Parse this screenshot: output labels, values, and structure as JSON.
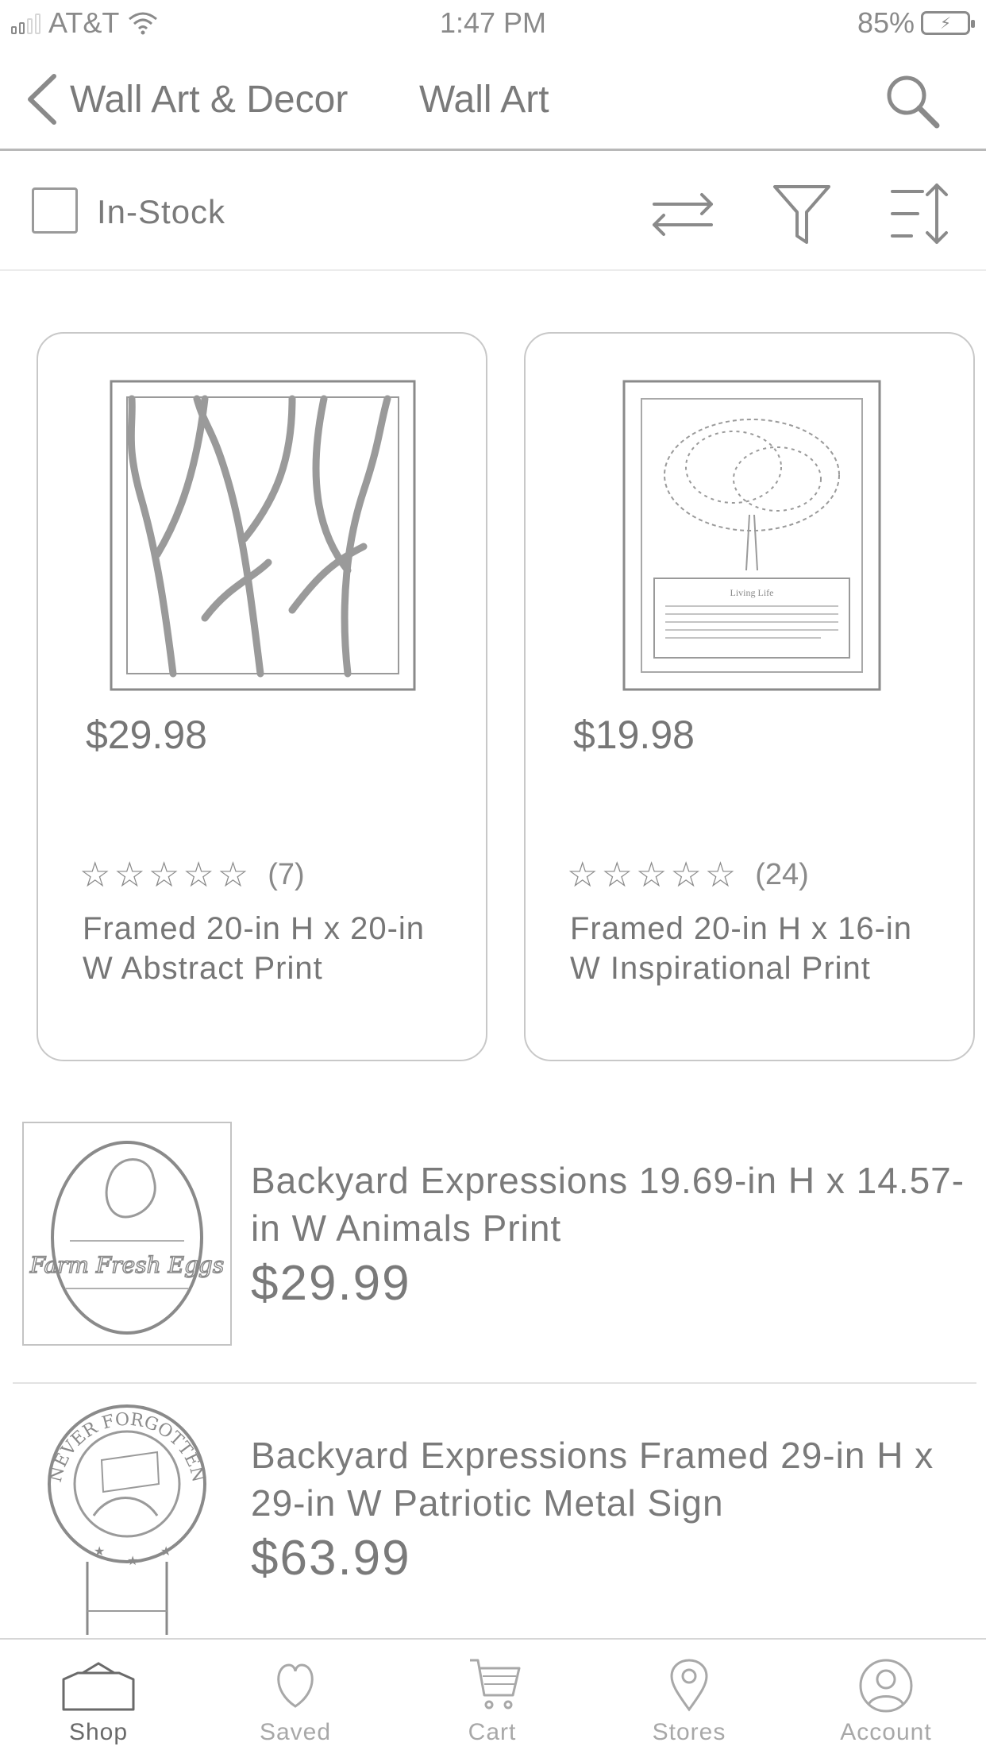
{
  "status_bar": {
    "carrier": "AT&T",
    "time": "1:47 PM",
    "battery": "85%"
  },
  "nav": {
    "parent": "Wall Art & Decor",
    "title": "Wall Art"
  },
  "filters": {
    "in_stock_label": "In-Stock",
    "in_stock_checked": false
  },
  "grid_products": [
    {
      "price": "$29.98",
      "stars": "☆☆☆☆☆",
      "rating_count": "(7)",
      "title": "Framed 20-in H x 20-in W Abstract Print"
    },
    {
      "price": "$19.98",
      "stars": "☆☆☆☆☆",
      "rating_count": "(24)",
      "title": "Framed 20-in H x 16-in W Inspirational Print",
      "art_heading": "Living Life"
    }
  ],
  "list_products": [
    {
      "title": "Backyard Expressions 19.69-in H x 14.57-in W Animals Print",
      "price": "$29.99",
      "art_text": "Farm Fresh Eggs"
    },
    {
      "title": "Backyard Expressions Framed 29-in H x 29-in W Patriotic Metal Sign",
      "price": "$63.99",
      "art_text": "NEVER FORGOTTEN"
    }
  ],
  "tabs": [
    {
      "label": "Shop",
      "icon": "shop-icon",
      "active": true
    },
    {
      "label": "Saved",
      "icon": "heart-icon",
      "active": false
    },
    {
      "label": "Cart",
      "icon": "cart-icon",
      "active": false
    },
    {
      "label": "Stores",
      "icon": "location-pin-icon",
      "active": false
    },
    {
      "label": "Account",
      "icon": "account-icon",
      "active": false
    }
  ]
}
